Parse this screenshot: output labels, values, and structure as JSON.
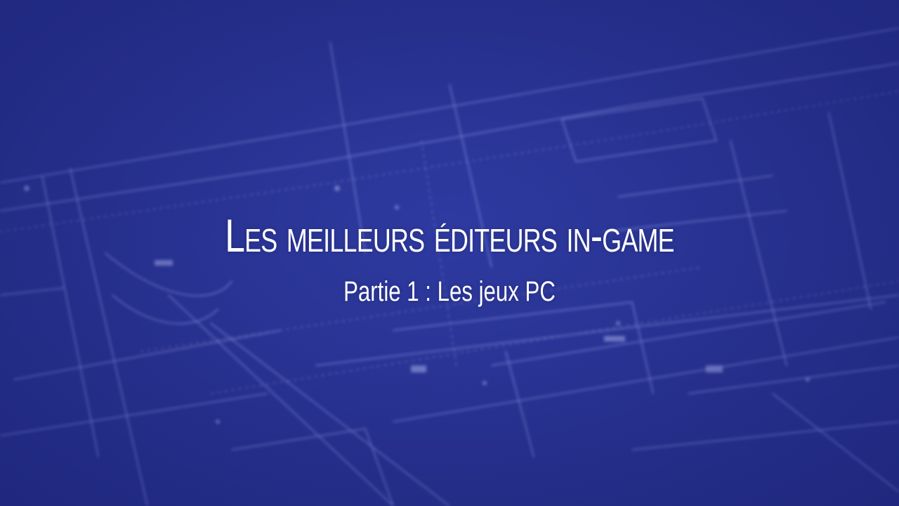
{
  "slide": {
    "title": "Les meilleurs éditeurs in-game",
    "subtitle": "Partie 1 : Les jeux PC",
    "background_image": "blurred-blueprint-background",
    "colors": {
      "background": "#27318f",
      "text": "#ffffff",
      "blueprint_lines": "#aab4ff"
    }
  }
}
